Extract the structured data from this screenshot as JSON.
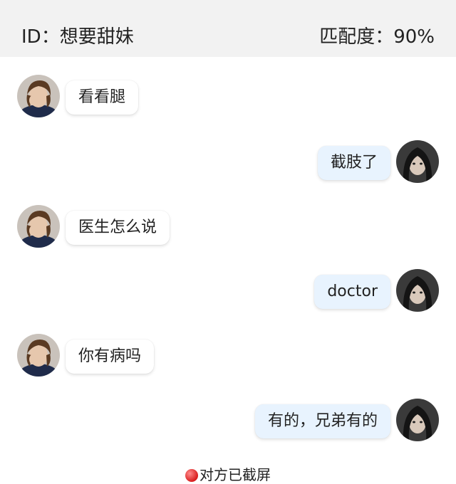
{
  "header": {
    "id_text": "ID：想要甜妹",
    "match_text": "匹配度：90%"
  },
  "messages": [
    {
      "side": "in",
      "text": "看看腿"
    },
    {
      "side": "out",
      "text": "截肢了"
    },
    {
      "side": "in",
      "text": "医生怎么说"
    },
    {
      "side": "out",
      "text": "doctor"
    },
    {
      "side": "in",
      "text": "你有病吗"
    },
    {
      "side": "out",
      "text": "有的，兄弟有的"
    }
  ],
  "footer": {
    "notice": "对方已截屏",
    "dot_color": "#d81e1e"
  },
  "colors": {
    "header_bg": "#f2f2f2",
    "incoming_bubble": "#ffffff",
    "outgoing_bubble": "#e8f3fe"
  }
}
